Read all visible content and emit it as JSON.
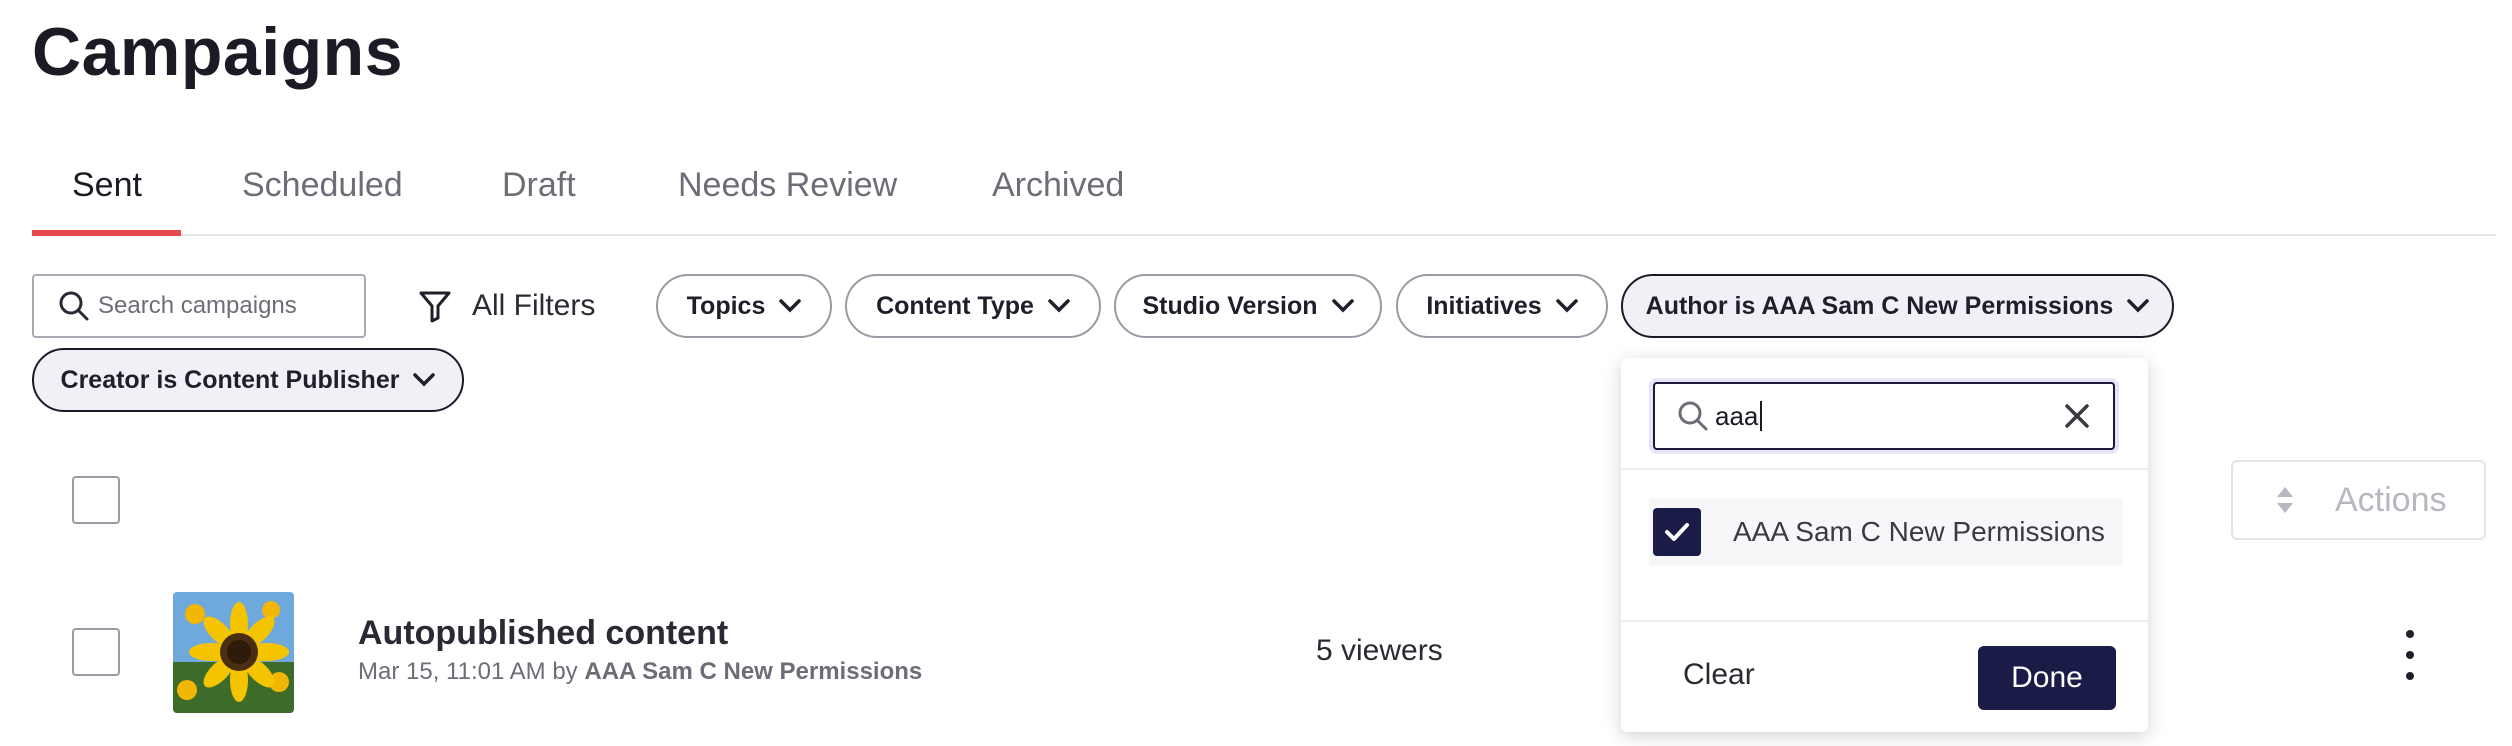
{
  "page": {
    "title": "Campaigns"
  },
  "tabs": [
    {
      "label": "Sent",
      "active": true
    },
    {
      "label": "Scheduled",
      "active": false
    },
    {
      "label": "Draft",
      "active": false
    },
    {
      "label": "Needs Review",
      "active": false
    },
    {
      "label": "Archived",
      "active": false
    }
  ],
  "search": {
    "placeholder": "Search campaigns"
  },
  "filters": {
    "all_filters_label": "All Filters",
    "chips": [
      {
        "label": "Topics",
        "selected": false
      },
      {
        "label": "Content Type",
        "selected": false
      },
      {
        "label": "Studio Version",
        "selected": false
      },
      {
        "label": "Initiatives",
        "selected": false
      },
      {
        "label": "Author is AAA Sam C New Permissions",
        "selected": true
      },
      {
        "label": "Creator is Content Publisher",
        "selected": true
      }
    ]
  },
  "toolbar": {
    "actions_label": "Actions"
  },
  "campaigns": [
    {
      "title": "Autopublished content",
      "date": "Mar 15, 11:01 AM",
      "by": "by",
      "author": "AAA Sam C New Permissions",
      "viewers": "5 viewers",
      "thumbnail": "sunflower-image"
    }
  ],
  "author_dropdown": {
    "search_value": "aaa",
    "options": [
      {
        "label": "AAA Sam C New Permissions",
        "checked": true
      }
    ],
    "clear_label": "Clear",
    "done_label": "Done"
  },
  "icons": {
    "search": "search-icon",
    "filter": "filter-funnel-icon",
    "chevron": "chevron-down-icon",
    "sort": "sort-arrows-icon",
    "close": "close-icon",
    "check": "check-icon",
    "more": "kebab-menu-icon"
  },
  "colors": {
    "accent_underline": "#e5484d",
    "primary_dark": "#1b1b48",
    "selected_chip_bg": "#f1f0f7"
  }
}
